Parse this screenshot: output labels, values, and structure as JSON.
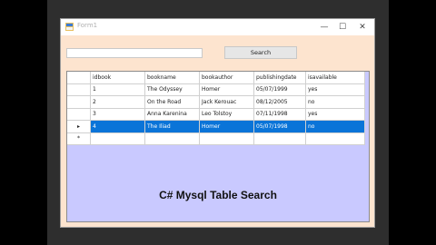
{
  "window": {
    "title": "Form1",
    "minimize_glyph": "—",
    "maximize_glyph": "☐",
    "close_glyph": "✕"
  },
  "search": {
    "input_value": "",
    "button_label": "Search"
  },
  "grid": {
    "columns": [
      "idbook",
      "bookname",
      "bookauthor",
      "publishingdate",
      "isavailable"
    ],
    "rows": [
      {
        "idbook": "1",
        "bookname": "The Odyssey",
        "bookauthor": "Homer",
        "publishingdate": "05/07/1999",
        "isavailable": "yes",
        "marker": ""
      },
      {
        "idbook": "2",
        "bookname": "On the Road",
        "bookauthor": "Jack Kerouac",
        "publishingdate": "08/12/2005",
        "isavailable": "no",
        "marker": ""
      },
      {
        "idbook": "3",
        "bookname": "Anna Karenina",
        "bookauthor": "Leo Tolstoy",
        "publishingdate": "07/11/1998",
        "isavailable": "yes",
        "marker": ""
      },
      {
        "idbook": "4",
        "bookname": "The Iliad",
        "bookauthor": "Homer",
        "publishingdate": "05/07/1998",
        "isavailable": "no",
        "marker": "▸"
      }
    ],
    "new_row_marker": "*",
    "selected_row_color": "#0a74d8"
  },
  "overlay": {
    "caption": "C# Mysql Table Search"
  },
  "colors": {
    "form_bg": "#fde4cf",
    "grid_bg": "#c9c9ff"
  }
}
